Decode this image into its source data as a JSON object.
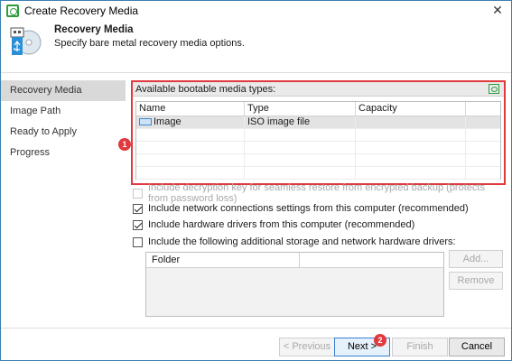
{
  "window": {
    "title": "Create Recovery Media",
    "close_glyph": "✕"
  },
  "header": {
    "title": "Recovery Media",
    "subtitle": "Specify bare metal recovery media options."
  },
  "sidebar": {
    "items": [
      {
        "label": "Recovery Media",
        "active": true
      },
      {
        "label": "Image Path",
        "active": false
      },
      {
        "label": "Ready to Apply",
        "active": false
      },
      {
        "label": "Progress",
        "active": false
      }
    ]
  },
  "media": {
    "label": "Available bootable media types:",
    "columns": [
      "Name",
      "Type",
      "Capacity"
    ],
    "rows": [
      {
        "name": "Image",
        "type": "ISO image file",
        "capacity": ""
      }
    ]
  },
  "badges": {
    "one": "1",
    "two": "2"
  },
  "options": {
    "decryption": {
      "label": "Include decryption key for seamless restore from encrypted backup (protects from password loss)",
      "checked": false,
      "enabled": false
    },
    "network": {
      "label": "Include network connections settings from this computer (recommended)",
      "checked": true,
      "enabled": true
    },
    "drivers": {
      "label": "Include hardware drivers from this computer (recommended)",
      "checked": true,
      "enabled": true
    },
    "additional": {
      "label": "Include the following additional storage and network hardware drivers:",
      "checked": false,
      "enabled": true
    }
  },
  "folder_grid": {
    "column": "Folder"
  },
  "side_buttons": {
    "add": "Add...",
    "remove": "Remove"
  },
  "footer": {
    "previous": "< Previous",
    "next": "Next >",
    "finish": "Finish",
    "cancel": "Cancel"
  },
  "colors": {
    "accent_red": "#e0393e",
    "veeam_green": "#2e9d3f",
    "selection": "#d9d9d9"
  }
}
